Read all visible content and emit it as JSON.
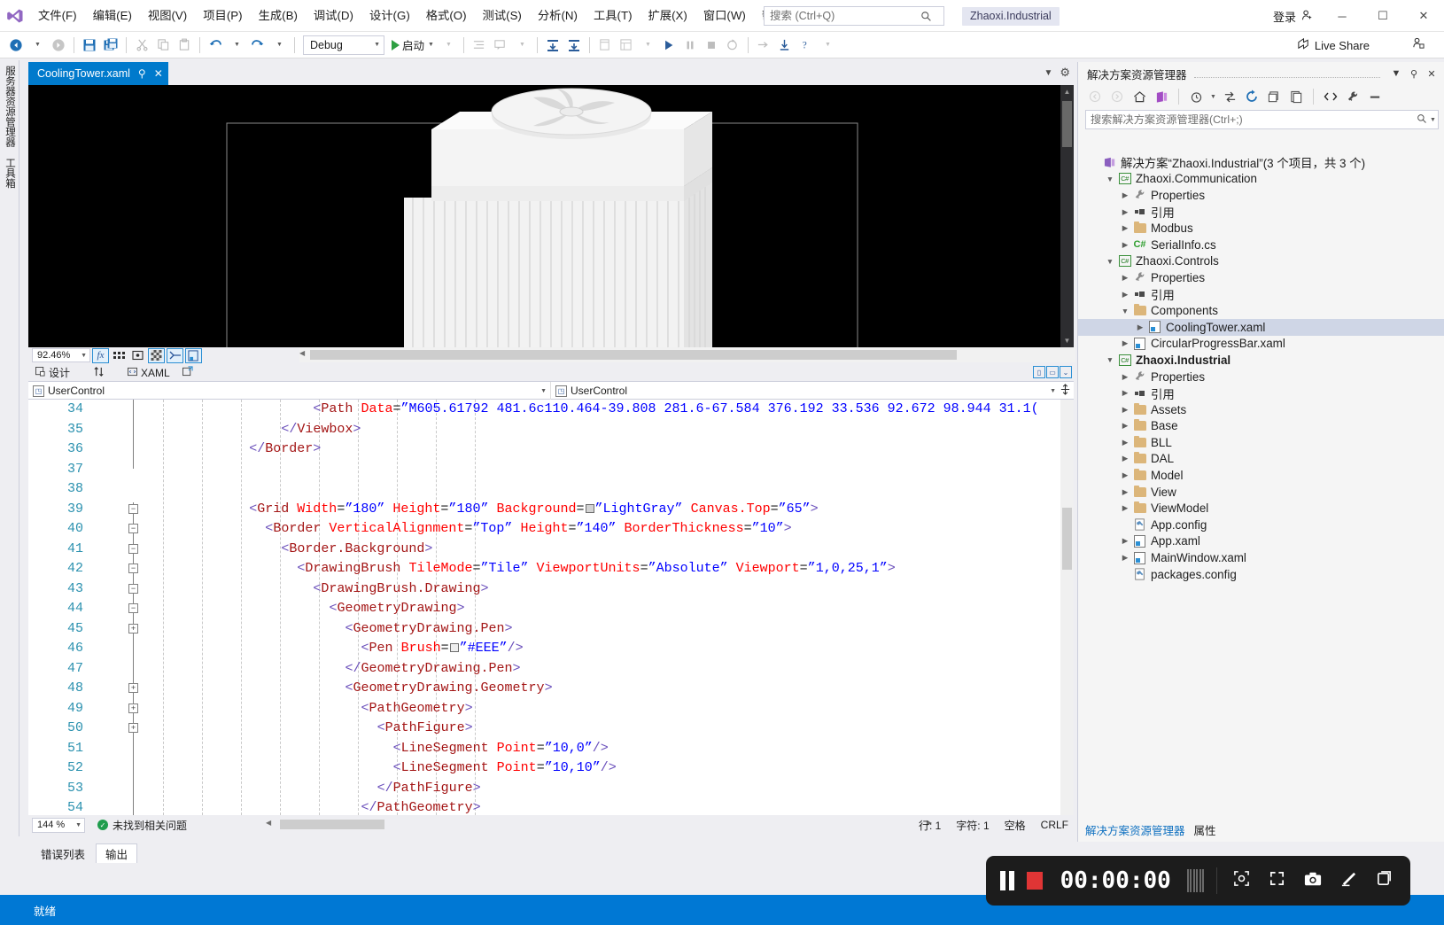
{
  "titlebar": {
    "logo_icon": "visual-studio-logo",
    "menus": [
      {
        "label": "文件(F)"
      },
      {
        "label": "编辑(E)"
      },
      {
        "label": "视图(V)"
      },
      {
        "label": "项目(P)"
      },
      {
        "label": "生成(B)"
      },
      {
        "label": "调试(D)"
      },
      {
        "label": "设计(G)"
      },
      {
        "label": "格式(O)"
      },
      {
        "label": "测试(S)"
      },
      {
        "label": "分析(N)"
      },
      {
        "label": "工具(T)"
      },
      {
        "label": "扩展(X)"
      },
      {
        "label": "窗口(W)"
      },
      {
        "label": "帮助(H)"
      }
    ],
    "search_placeholder": "搜索 (Ctrl+Q)",
    "search_value": "",
    "project_chip": "Zhaoxi.Industrial",
    "signin_label": "登录",
    "minimize": "─",
    "maximize": "☐",
    "close": "✕"
  },
  "toolbar": {
    "config_value": "Debug",
    "run_label": "启动",
    "live_share_label": "Live Share"
  },
  "left_tabs": [
    {
      "label": "服务器资源管理器"
    },
    {
      "label": "工具箱"
    }
  ],
  "document_tab": {
    "title": "CoolingTower.xaml",
    "pin_icon": "pin-icon",
    "close_icon": "close-icon"
  },
  "designer": {
    "zoom_level": "92.46%",
    "design_label": "设计",
    "xaml_label": "XAML",
    "swap_icon": "swap-vertical-icon",
    "popout_icon": "popout-icon"
  },
  "code_editor": {
    "left_dropdown": "UserControl",
    "right_dropdown": "UserControl",
    "lines": [
      {
        "n": "34",
        "indent": 21,
        "tokens": [
          {
            "t": "br",
            "s": "<"
          },
          {
            "t": "tag",
            "s": "Path"
          },
          {
            "t": "sp",
            "s": " "
          },
          {
            "t": "attr",
            "s": "Data"
          },
          {
            "t": "eq",
            "s": "="
          },
          {
            "t": "q",
            "s": "”"
          },
          {
            "t": "val",
            "s": "M605.61792 481.6c110.464-39.808 281.6-67.584 376.192 33.536 92.672 98.944 31.1("
          }
        ]
      },
      {
        "n": "35",
        "indent": 17,
        "tokens": [
          {
            "t": "br",
            "s": "</"
          },
          {
            "t": "tag",
            "s": "Viewbox"
          },
          {
            "t": "br",
            "s": ">"
          }
        ]
      },
      {
        "n": "36",
        "indent": 13,
        "tokens": [
          {
            "t": "br",
            "s": "</"
          },
          {
            "t": "tag",
            "s": "Border"
          },
          {
            "t": "br",
            "s": ">"
          }
        ]
      },
      {
        "n": "37",
        "indent": 0,
        "tokens": []
      },
      {
        "n": "38",
        "indent": 0,
        "tokens": []
      },
      {
        "n": "39",
        "indent": 13,
        "fold": "minus",
        "tokens": [
          {
            "t": "br",
            "s": "<"
          },
          {
            "t": "tag",
            "s": "Grid"
          },
          {
            "t": "sp",
            "s": " "
          },
          {
            "t": "attr",
            "s": "Width"
          },
          {
            "t": "eq",
            "s": "="
          },
          {
            "t": "q",
            "s": "”"
          },
          {
            "t": "val",
            "s": "180"
          },
          {
            "t": "q",
            "s": "”"
          },
          {
            "t": "sp",
            "s": " "
          },
          {
            "t": "attr",
            "s": "Height"
          },
          {
            "t": "eq",
            "s": "="
          },
          {
            "t": "q",
            "s": "”"
          },
          {
            "t": "val",
            "s": "180"
          },
          {
            "t": "q",
            "s": "”"
          },
          {
            "t": "sp",
            "s": " "
          },
          {
            "t": "attr",
            "s": "Background"
          },
          {
            "t": "eq",
            "s": "="
          },
          {
            "t": "swatch",
            "s": "#d3d3d3"
          },
          {
            "t": "q",
            "s": "”"
          },
          {
            "t": "val",
            "s": "LightGray"
          },
          {
            "t": "q",
            "s": "”"
          },
          {
            "t": "sp",
            "s": " "
          },
          {
            "t": "attr",
            "s": "Canvas.Top"
          },
          {
            "t": "eq",
            "s": "="
          },
          {
            "t": "q",
            "s": "”"
          },
          {
            "t": "val",
            "s": "65"
          },
          {
            "t": "q",
            "s": "”"
          },
          {
            "t": "br",
            "s": ">"
          }
        ]
      },
      {
        "n": "40",
        "indent": 15,
        "fold": "minus",
        "tokens": [
          {
            "t": "br",
            "s": "<"
          },
          {
            "t": "tag",
            "s": "Border"
          },
          {
            "t": "sp",
            "s": " "
          },
          {
            "t": "attr",
            "s": "VerticalAlignment"
          },
          {
            "t": "eq",
            "s": "="
          },
          {
            "t": "q",
            "s": "”"
          },
          {
            "t": "val",
            "s": "Top"
          },
          {
            "t": "q",
            "s": "”"
          },
          {
            "t": "sp",
            "s": " "
          },
          {
            "t": "attr",
            "s": "Height"
          },
          {
            "t": "eq",
            "s": "="
          },
          {
            "t": "q",
            "s": "”"
          },
          {
            "t": "val",
            "s": "140"
          },
          {
            "t": "q",
            "s": "”"
          },
          {
            "t": "sp",
            "s": " "
          },
          {
            "t": "attr",
            "s": "BorderThickness"
          },
          {
            "t": "eq",
            "s": "="
          },
          {
            "t": "q",
            "s": "”"
          },
          {
            "t": "val",
            "s": "10"
          },
          {
            "t": "q",
            "s": "”"
          },
          {
            "t": "br",
            "s": ">"
          }
        ]
      },
      {
        "n": "41",
        "indent": 17,
        "fold": "minus",
        "tokens": [
          {
            "t": "br",
            "s": "<"
          },
          {
            "t": "tag",
            "s": "Border.Background"
          },
          {
            "t": "br",
            "s": ">"
          }
        ]
      },
      {
        "n": "42",
        "indent": 19,
        "fold": "minus",
        "tokens": [
          {
            "t": "br",
            "s": "<"
          },
          {
            "t": "tag",
            "s": "DrawingBrush"
          },
          {
            "t": "sp",
            "s": " "
          },
          {
            "t": "attr",
            "s": "TileMode"
          },
          {
            "t": "eq",
            "s": "="
          },
          {
            "t": "q",
            "s": "”"
          },
          {
            "t": "val",
            "s": "Tile"
          },
          {
            "t": "q",
            "s": "”"
          },
          {
            "t": "sp",
            "s": " "
          },
          {
            "t": "attr",
            "s": "ViewportUnits"
          },
          {
            "t": "eq",
            "s": "="
          },
          {
            "t": "q",
            "s": "”"
          },
          {
            "t": "val",
            "s": "Absolute"
          },
          {
            "t": "q",
            "s": "”"
          },
          {
            "t": "sp",
            "s": " "
          },
          {
            "t": "attr",
            "s": "Viewport"
          },
          {
            "t": "eq",
            "s": "="
          },
          {
            "t": "q",
            "s": "”"
          },
          {
            "t": "val",
            "s": "1,0,25,1"
          },
          {
            "t": "q",
            "s": "”"
          },
          {
            "t": "br",
            "s": ">"
          }
        ]
      },
      {
        "n": "43",
        "indent": 21,
        "fold": "minus",
        "tokens": [
          {
            "t": "br",
            "s": "<"
          },
          {
            "t": "tag",
            "s": "DrawingBrush.Drawing"
          },
          {
            "t": "br",
            "s": ">"
          }
        ]
      },
      {
        "n": "44",
        "indent": 23,
        "fold": "minus",
        "tokens": [
          {
            "t": "br",
            "s": "<"
          },
          {
            "t": "tag",
            "s": "GeometryDrawing"
          },
          {
            "t": "br",
            "s": ">"
          }
        ]
      },
      {
        "n": "45",
        "indent": 25,
        "fold": "plus",
        "tokens": [
          {
            "t": "br",
            "s": "<"
          },
          {
            "t": "tag",
            "s": "GeometryDrawing.Pen"
          },
          {
            "t": "br",
            "s": ">"
          }
        ]
      },
      {
        "n": "46",
        "indent": 27,
        "tokens": [
          {
            "t": "br",
            "s": "<"
          },
          {
            "t": "tag",
            "s": "Pen"
          },
          {
            "t": "sp",
            "s": " "
          },
          {
            "t": "attr",
            "s": "Brush"
          },
          {
            "t": "eq",
            "s": "="
          },
          {
            "t": "swatch",
            "s": "#eeeeee"
          },
          {
            "t": "q",
            "s": "”"
          },
          {
            "t": "val",
            "s": "#EEE"
          },
          {
            "t": "q",
            "s": "”"
          },
          {
            "t": "br",
            "s": "/>"
          }
        ]
      },
      {
        "n": "47",
        "indent": 25,
        "tokens": [
          {
            "t": "br",
            "s": "</"
          },
          {
            "t": "tag",
            "s": "GeometryDrawing.Pen"
          },
          {
            "t": "br",
            "s": ">"
          }
        ]
      },
      {
        "n": "48",
        "indent": 25,
        "fold": "plus",
        "tokens": [
          {
            "t": "br",
            "s": "<"
          },
          {
            "t": "tag",
            "s": "GeometryDrawing.Geometry"
          },
          {
            "t": "br",
            "s": ">"
          }
        ]
      },
      {
        "n": "49",
        "indent": 27,
        "fold": "plus",
        "tokens": [
          {
            "t": "br",
            "s": "<"
          },
          {
            "t": "tag",
            "s": "PathGeometry"
          },
          {
            "t": "br",
            "s": ">"
          }
        ]
      },
      {
        "n": "50",
        "indent": 29,
        "fold": "plus",
        "tokens": [
          {
            "t": "br",
            "s": "<"
          },
          {
            "t": "tag",
            "s": "PathFigure"
          },
          {
            "t": "br",
            "s": ">"
          }
        ]
      },
      {
        "n": "51",
        "indent": 31,
        "tokens": [
          {
            "t": "br",
            "s": "<"
          },
          {
            "t": "tag",
            "s": "LineSegment"
          },
          {
            "t": "sp",
            "s": " "
          },
          {
            "t": "attr",
            "s": "Point"
          },
          {
            "t": "eq",
            "s": "="
          },
          {
            "t": "q",
            "s": "”"
          },
          {
            "t": "val",
            "s": "10,0"
          },
          {
            "t": "q",
            "s": "”"
          },
          {
            "t": "br",
            "s": "/>"
          }
        ]
      },
      {
        "n": "52",
        "indent": 31,
        "tokens": [
          {
            "t": "br",
            "s": "<"
          },
          {
            "t": "tag",
            "s": "LineSegment"
          },
          {
            "t": "sp",
            "s": " "
          },
          {
            "t": "attr",
            "s": "Point"
          },
          {
            "t": "eq",
            "s": "="
          },
          {
            "t": "q",
            "s": "”"
          },
          {
            "t": "val",
            "s": "10,10"
          },
          {
            "t": "q",
            "s": "”"
          },
          {
            "t": "br",
            "s": "/>"
          }
        ]
      },
      {
        "n": "53",
        "indent": 29,
        "tokens": [
          {
            "t": "br",
            "s": "</"
          },
          {
            "t": "tag",
            "s": "PathFigure"
          },
          {
            "t": "br",
            "s": ">"
          }
        ]
      },
      {
        "n": "54",
        "indent": 27,
        "tokens": [
          {
            "t": "br",
            "s": "</"
          },
          {
            "t": "tag",
            "s": "PathGeometry"
          },
          {
            "t": "br",
            "s": ">"
          }
        ]
      }
    ]
  },
  "editor_status": {
    "zoom_level": "144 %",
    "issues_text": "未找到相关问题",
    "line_label": "行: 1",
    "col_label": "字符: 1",
    "spaces_label": "空格",
    "eol_label": "CRLF"
  },
  "bottom_tabs": [
    {
      "label": "错误列表",
      "active": false
    },
    {
      "label": "输出",
      "active": true
    }
  ],
  "solution_explorer": {
    "title": "解决方案资源管理器",
    "search_placeholder": "搜索解决方案资源管理器(Ctrl+;)",
    "search_value": "",
    "dropdown_icon": "chevron-down-icon",
    "pin_icon": "pin-icon",
    "close_icon": "close-icon",
    "tree": [
      {
        "depth": 0,
        "arrow": "",
        "icon": "solution-icon",
        "label": "解决方案“Zhaoxi.Industrial”(3 个项目，共 3 个)",
        "bold": false,
        "selected": false
      },
      {
        "depth": 1,
        "arrow": "▼",
        "icon": "csharp-project-icon",
        "label": "Zhaoxi.Communication",
        "bold": false,
        "selected": false
      },
      {
        "depth": 2,
        "arrow": "▶",
        "icon": "wrench-icon",
        "label": "Properties",
        "bold": false,
        "selected": false
      },
      {
        "depth": 2,
        "arrow": "▶",
        "icon": "references-icon",
        "label": "引用",
        "bold": false,
        "selected": false
      },
      {
        "depth": 2,
        "arrow": "▶",
        "icon": "folder-icon",
        "label": "Modbus",
        "bold": false,
        "selected": false
      },
      {
        "depth": 2,
        "arrow": "▶",
        "icon": "csharp-file-icon",
        "label": "SerialInfo.cs",
        "bold": false,
        "selected": false
      },
      {
        "depth": 1,
        "arrow": "▼",
        "icon": "csharp-project-icon",
        "label": "Zhaoxi.Controls",
        "bold": false,
        "selected": false
      },
      {
        "depth": 2,
        "arrow": "▶",
        "icon": "wrench-icon",
        "label": "Properties",
        "bold": false,
        "selected": false
      },
      {
        "depth": 2,
        "arrow": "▶",
        "icon": "references-icon",
        "label": "引用",
        "bold": false,
        "selected": false
      },
      {
        "depth": 2,
        "arrow": "▼",
        "icon": "folder-icon",
        "label": "Components",
        "bold": false,
        "selected": false
      },
      {
        "depth": 3,
        "arrow": "▶",
        "icon": "xaml-file-icon",
        "label": "CoolingTower.xaml",
        "bold": false,
        "selected": true
      },
      {
        "depth": 2,
        "arrow": "▶",
        "icon": "xaml-file-icon",
        "label": "CircularProgressBar.xaml",
        "bold": false,
        "selected": false
      },
      {
        "depth": 1,
        "arrow": "▼",
        "icon": "csharp-project-icon",
        "label": "Zhaoxi.Industrial",
        "bold": true,
        "selected": false
      },
      {
        "depth": 2,
        "arrow": "▶",
        "icon": "wrench-icon",
        "label": "Properties",
        "bold": false,
        "selected": false
      },
      {
        "depth": 2,
        "arrow": "▶",
        "icon": "references-icon",
        "label": "引用",
        "bold": false,
        "selected": false
      },
      {
        "depth": 2,
        "arrow": "▶",
        "icon": "folder-icon",
        "label": "Assets",
        "bold": false,
        "selected": false
      },
      {
        "depth": 2,
        "arrow": "▶",
        "icon": "folder-icon",
        "label": "Base",
        "bold": false,
        "selected": false
      },
      {
        "depth": 2,
        "arrow": "▶",
        "icon": "folder-icon",
        "label": "BLL",
        "bold": false,
        "selected": false
      },
      {
        "depth": 2,
        "arrow": "▶",
        "icon": "folder-icon",
        "label": "DAL",
        "bold": false,
        "selected": false
      },
      {
        "depth": 2,
        "arrow": "▶",
        "icon": "folder-icon",
        "label": "Model",
        "bold": false,
        "selected": false
      },
      {
        "depth": 2,
        "arrow": "▶",
        "icon": "folder-icon",
        "label": "View",
        "bold": false,
        "selected": false
      },
      {
        "depth": 2,
        "arrow": "▶",
        "icon": "folder-icon",
        "label": "ViewModel",
        "bold": false,
        "selected": false
      },
      {
        "depth": 2,
        "arrow": "",
        "icon": "config-file-icon",
        "label": "App.config",
        "bold": false,
        "selected": false
      },
      {
        "depth": 2,
        "arrow": "▶",
        "icon": "xaml-file-icon",
        "label": "App.xaml",
        "bold": false,
        "selected": false
      },
      {
        "depth": 2,
        "arrow": "▶",
        "icon": "xaml-file-icon",
        "label": "MainWindow.xaml",
        "bold": false,
        "selected": false
      },
      {
        "depth": 2,
        "arrow": "",
        "icon": "config-file-icon",
        "label": "packages.config",
        "bold": false,
        "selected": false
      }
    ],
    "bottom_tabs": [
      {
        "label": "解决方案资源管理器",
        "active": true
      },
      {
        "label": "属性",
        "active": false
      }
    ]
  },
  "taskbar": {
    "status_label": "就绪"
  },
  "recorder": {
    "pause_icon": "pause-icon",
    "stop_icon": "stop-record-icon",
    "time": "00:00:00",
    "region_icon": "capture-region-icon",
    "fullscreen_icon": "fullscreen-icon",
    "camera_icon": "camera-icon",
    "pen_icon": "pen-icon",
    "window_icon": "window-icon"
  },
  "colors": {
    "accent": "#007acc",
    "taskbar": "#0078d4",
    "selection": "#cfd6e6",
    "tag": "#a31515",
    "attr": "#ff0000",
    "value": "#0000ff",
    "bracket": "#6a4fbb",
    "linenum": "#2b91af"
  }
}
